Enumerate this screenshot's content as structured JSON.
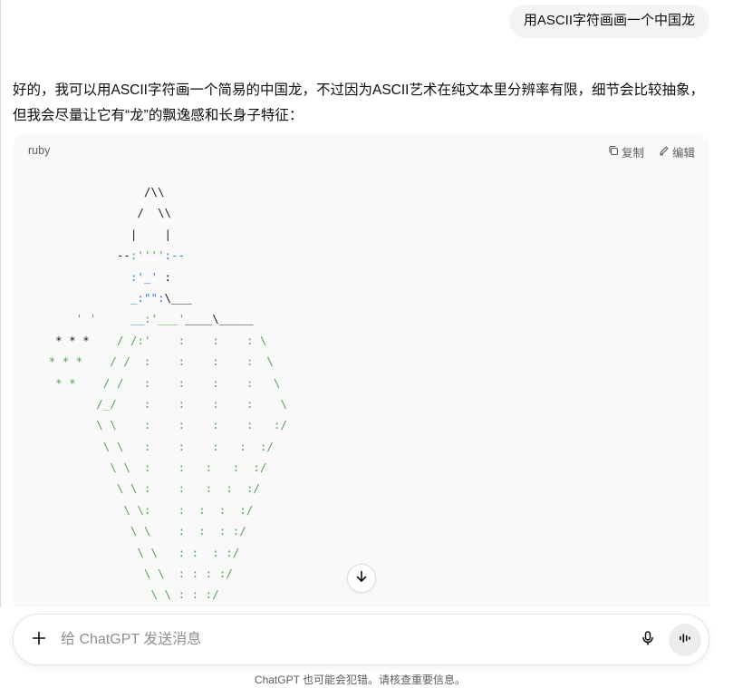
{
  "user_message": "用ASCII字符画画一个中国龙",
  "assistant": {
    "paragraph": "好的，我可以用ASCII字符画一个简易的中国龙，不过因为ASCII艺术在纯文本里分辨率有限，细节会比较抽象，但我会尽量让它有“龙”的飘逸感和长身子特征："
  },
  "code_block": {
    "language": "ruby",
    "copy_label": "复制",
    "edit_label": "编辑",
    "lines": [
      [
        {
          "t": "                 /\\\\",
          "c": ""
        }
      ],
      [
        {
          "t": "                /  \\\\",
          "c": ""
        }
      ],
      [
        {
          "t": "               |    |",
          "c": ""
        }
      ],
      [
        {
          "t": "             --",
          "c": ""
        },
        {
          "t": ":''''",
          "c": "g"
        },
        {
          "t": ":--",
          "c": "b"
        }
      ],
      [
        {
          "t": "               ",
          "c": ""
        },
        {
          "t": ":'_'",
          "c": "b"
        },
        {
          "t": " :",
          "c": ""
        }
      ],
      [
        {
          "t": "               ",
          "c": ""
        },
        {
          "t": "_:\"\":",
          "c": "b"
        },
        {
          "t": "\\___",
          "c": ""
        }
      ],
      [
        {
          "t": "       ' '",
          "c": "g"
        },
        {
          "t": "     __",
          "c": "b"
        },
        {
          "t": ":'___'",
          "c": "g"
        },
        {
          "t": "____\\_____",
          "c": ""
        }
      ],
      [
        {
          "t": "    * * *",
          "c": ""
        },
        {
          "t": "    / /:'    :    :    : \\",
          "c": "g"
        }
      ],
      [
        {
          "t": "   * * *    / /  :    :    :    :  \\",
          "c": "g"
        }
      ],
      [
        {
          "t": "    * *    / /   :    :    :    :   \\",
          "c": "g"
        }
      ],
      [
        {
          "t": "          /_/    :    :    :    :    \\",
          "c": "g"
        }
      ],
      [
        {
          "t": "          \\ \\    :    :    :    :   :/",
          "c": "g"
        }
      ],
      [
        {
          "t": "           \\ \\   :    :    :   :  :/",
          "c": "g"
        }
      ],
      [
        {
          "t": "            \\ \\  :    :   :   :  :/",
          "c": "g"
        }
      ],
      [
        {
          "t": "             \\ \\ :    :   :  :  :/",
          "c": "g"
        }
      ],
      [
        {
          "t": "              \\ \\:    :  :  :  :/",
          "c": "g"
        }
      ],
      [
        {
          "t": "               \\ \\    :  :  : :/",
          "c": "g"
        }
      ],
      [
        {
          "t": "                \\ \\   : :  : :/",
          "c": "g"
        }
      ],
      [
        {
          "t": "                 \\ \\  : : : :/",
          "c": "g"
        }
      ],
      [
        {
          "t": "                  \\ \\ : : :/",
          "c": "g"
        }
      ]
    ]
  },
  "composer": {
    "placeholder": "给 ChatGPT 发送消息"
  },
  "disclaimer": "ChatGPT 也可能会犯错。请核查重要信息。",
  "icons": {
    "copy": "copy-icon",
    "edit": "edit-pencil-icon",
    "plus": "plus-icon",
    "mic": "microphone-icon",
    "voice": "voice-waveform-icon",
    "scroll": "arrow-down-icon"
  },
  "colors": {
    "code_green": "#52a552",
    "code_blue": "#3b7dd8",
    "bubble_bg": "#f4f4f4",
    "code_bg": "#f9f9f9"
  }
}
